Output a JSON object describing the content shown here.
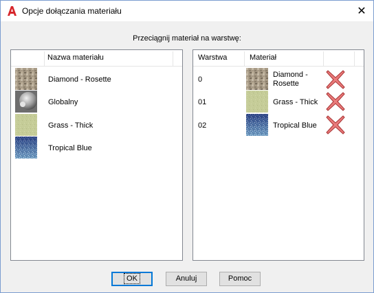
{
  "window": {
    "title": "Opcje dołączania materiału",
    "close_glyph": "✕",
    "app_icon": "autocad-a-icon",
    "app_icon_color": "#d6252a"
  },
  "instruction": "Przeciągnij materiał na warstwę:",
  "materials_list": {
    "header": "Nazwa materiału",
    "items": [
      {
        "label": "Diamond - Rosette",
        "swatch": "stone-texture"
      },
      {
        "label": "Globalny",
        "swatch": "gray-sphere"
      },
      {
        "label": "Grass - Thick",
        "swatch": "grass-texture"
      },
      {
        "label": "Tropical Blue",
        "swatch": "blue-speckle-texture"
      }
    ]
  },
  "layer_table": {
    "columns": [
      "Warstwa",
      "Materiał"
    ],
    "rows": [
      {
        "layer": "0",
        "material_line1": "Diamond -",
        "material_line2": "Rosette",
        "swatch": "stone-texture"
      },
      {
        "layer": "01",
        "material_line1": "Grass - Thick",
        "material_line2": "",
        "swatch": "grass-texture"
      },
      {
        "layer": "02",
        "material_line1": "Tropical Blue",
        "material_line2": "",
        "swatch": "blue-speckle-texture"
      }
    ],
    "delete_icon": "red-x-delete-icon",
    "delete_color": "#d9534f"
  },
  "buttons": {
    "ok": "OK",
    "cancel": "Anuluj",
    "help": "Pomoc"
  }
}
